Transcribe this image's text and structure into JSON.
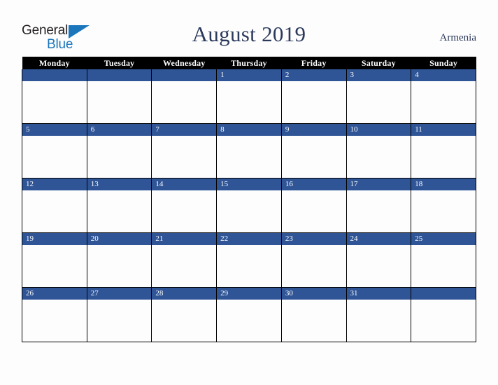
{
  "brand": {
    "name_part1": "General",
    "name_part2": "Blue",
    "triangle_icon": "triangle-icon",
    "color_dark": "#231f20",
    "color_blue": "#1b76bc"
  },
  "header": {
    "title": "August 2019",
    "region": "Armenia",
    "title_color": "#2b3a5c"
  },
  "calendar": {
    "weekday_headers": [
      "Monday",
      "Tuesday",
      "Wednesday",
      "Thursday",
      "Friday",
      "Saturday",
      "Sunday"
    ],
    "header_bg": "#000000",
    "header_text_color": "#ffffff",
    "date_band_bg": "#2f5597",
    "date_text_color": "#ffffff",
    "cell_bg": "#fdfdfd",
    "grid_line_color": "#000000",
    "weeks": [
      {
        "days": [
          {
            "num": ""
          },
          {
            "num": ""
          },
          {
            "num": ""
          },
          {
            "num": "1"
          },
          {
            "num": "2"
          },
          {
            "num": "3"
          },
          {
            "num": "4"
          }
        ]
      },
      {
        "days": [
          {
            "num": "5"
          },
          {
            "num": "6"
          },
          {
            "num": "7"
          },
          {
            "num": "8"
          },
          {
            "num": "9"
          },
          {
            "num": "10"
          },
          {
            "num": "11"
          }
        ]
      },
      {
        "days": [
          {
            "num": "12"
          },
          {
            "num": "13"
          },
          {
            "num": "14"
          },
          {
            "num": "15"
          },
          {
            "num": "16"
          },
          {
            "num": "17"
          },
          {
            "num": "18"
          }
        ]
      },
      {
        "days": [
          {
            "num": "19"
          },
          {
            "num": "20"
          },
          {
            "num": "21"
          },
          {
            "num": "22"
          },
          {
            "num": "23"
          },
          {
            "num": "24"
          },
          {
            "num": "25"
          }
        ]
      },
      {
        "days": [
          {
            "num": "26"
          },
          {
            "num": "27"
          },
          {
            "num": "28"
          },
          {
            "num": "29"
          },
          {
            "num": "30"
          },
          {
            "num": "31"
          },
          {
            "num": ""
          }
        ]
      }
    ]
  }
}
